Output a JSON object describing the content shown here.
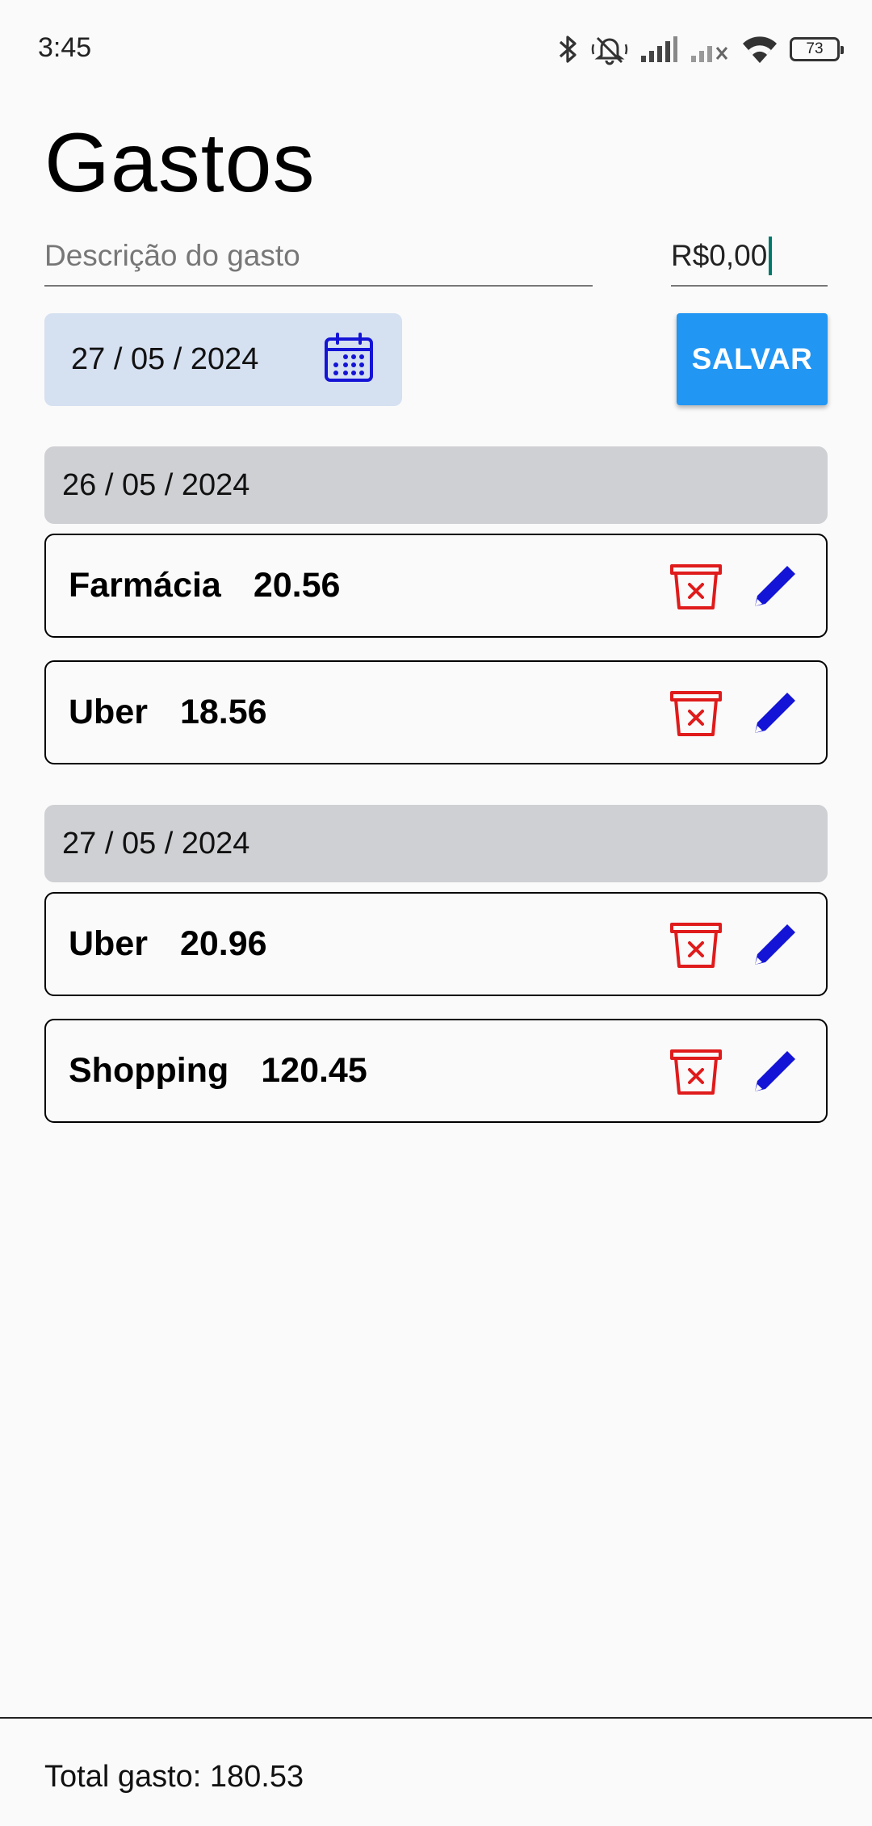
{
  "status_bar": {
    "time": "3:45",
    "battery": "73",
    "icons": [
      "bluetooth-icon",
      "bell-off-icon",
      "signal-icon",
      "signal-off-icon",
      "wifi-icon",
      "battery-icon"
    ]
  },
  "title": "Gastos",
  "form": {
    "description_placeholder": "Descrição do gasto",
    "description_value": "",
    "amount_value": "R$0,00",
    "date": "27 / 05 / 2024",
    "save_label": "SALVAR"
  },
  "groups": [
    {
      "date": "26 / 05 / 2024",
      "items": [
        {
          "description": "Farmácia",
          "amount": "20.56"
        },
        {
          "description": "Uber",
          "amount": "18.56"
        }
      ]
    },
    {
      "date": "27 / 05 / 2024",
      "items": [
        {
          "description": "Uber",
          "amount": "20.96"
        },
        {
          "description": "Shopping",
          "amount": "120.45"
        }
      ]
    }
  ],
  "footer": {
    "total": "Total gasto: 180.53"
  },
  "colors": {
    "accent": "#2196f3",
    "delete": "#e01b1b",
    "edit": "#1414d6",
    "date_picker_bg": "#d5e0f1",
    "group_header_bg": "#cfd0d4"
  }
}
